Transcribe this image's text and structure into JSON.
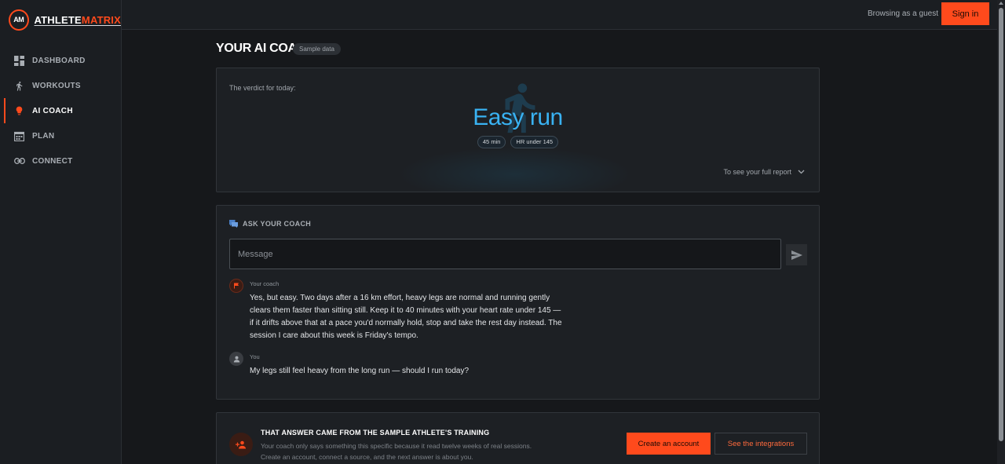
{
  "brand": {
    "badge": "AM",
    "name_part1": "ATHLETE",
    "name_part2": "MATRIX"
  },
  "nav": {
    "items": [
      {
        "label": "DASHBOARD",
        "icon": "dashboard-icon"
      },
      {
        "label": "WORKOUTS",
        "icon": "runner-icon"
      },
      {
        "label": "AI COACH",
        "icon": "coach-icon",
        "active": true
      },
      {
        "label": "PLAN",
        "icon": "calendar-icon"
      },
      {
        "label": "CONNECT",
        "icon": "link-icon"
      }
    ]
  },
  "topbar": {
    "guest_text": "Browsing as a guest",
    "signin_label": "Sign in"
  },
  "page": {
    "title": "YOUR AI COACH",
    "badge": "Sample data"
  },
  "verdict": {
    "label": "The verdict for today:",
    "value": "Easy run",
    "chips": [
      "45 min",
      "HR under 145"
    ],
    "report_link": "To see your full report"
  },
  "chat": {
    "title": "ASK YOUR COACH",
    "input_placeholder": "Message",
    "messages": [
      {
        "author": "Your coach",
        "text": "Yes, but easy. Two days after a 16 km effort, heavy legs are normal and running gently clears them faster than sitting still. Keep it to 40 minutes with your heart rate under 145 — if it drifts above that at a pace you'd normally hold, stop and take the rest day instead. The session I care about this week is Friday's tempo."
      },
      {
        "author": "You",
        "text": "My legs still feel heavy from the long run — should I run today?"
      }
    ]
  },
  "cta": {
    "title": "THAT ANSWER CAME FROM THE SAMPLE ATHLETE'S TRAINING",
    "text": "Your coach only says something this specific because it read twelve weeks of real sessions. Create an account, connect a source, and the next answer is about you.",
    "primary_label": "Create an account",
    "secondary_label": "See the integrations"
  },
  "colors": {
    "accent": "#ff4a1c",
    "verdict": "#39b2f2",
    "background": "#16181b"
  }
}
